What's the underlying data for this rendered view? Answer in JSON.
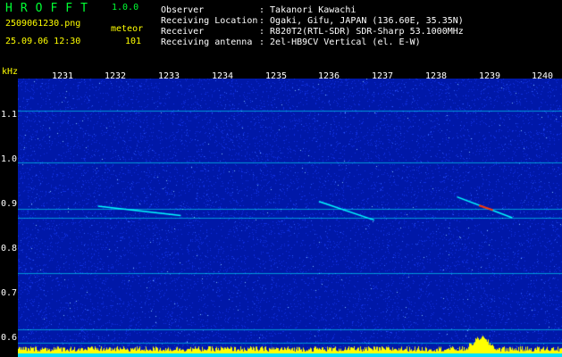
{
  "app": {
    "title": "HROFFT",
    "version": "1.0.0"
  },
  "file": {
    "filename": "2509061230.png",
    "datetime": "25.09.06 12:30",
    "mode_label": "meteor",
    "count": "101"
  },
  "info": [
    {
      "label": "Observer",
      "value": ": Takanori Kawachi"
    },
    {
      "label": "Receiving Location",
      "value": ": Ogaki, Gifu, JAPAN (136.60E, 35.35N)"
    },
    {
      "label": "Receiver",
      "value": ": R820T2(RTL-SDR) SDR-Sharp 53.1000MHz"
    },
    {
      "label": "Receiving antenna",
      "value": ": 2el-HB9CV Vertical (el. E-W)"
    }
  ],
  "axis": {
    "unit": "kHz",
    "y_ticks": [
      "1.1",
      "1.0",
      "0.9",
      "0.8",
      "0.7",
      "0.6"
    ],
    "x_ticks": [
      "1231",
      "1232",
      "1233",
      "1234",
      "1235",
      "1236",
      "1237",
      "1238",
      "1239",
      "1240"
    ]
  },
  "colors": {
    "background": "#0018a8",
    "noise": "#1030e0",
    "signal": "#00ffff",
    "hot": "#ff3000",
    "footer": "#ffff00"
  },
  "chart_data": {
    "type": "heatmap",
    "x": [
      "1231",
      "1232",
      "1233",
      "1234",
      "1235",
      "1236",
      "1237",
      "1238",
      "1239",
      "1240"
    ],
    "y_unit": "kHz",
    "ylim": [
      0.59,
      1.19
    ],
    "carriers_khz": [
      1.12,
      1.01,
      0.91,
      0.89,
      0.77,
      0.65,
      0.62
    ],
    "meteor_traces": [
      {
        "start_minute": 1232.0,
        "end_minute": 1233.5,
        "start_khz": 0.915,
        "end_khz": 0.895
      },
      {
        "start_minute": 1236.0,
        "end_minute": 1237.0,
        "start_khz": 0.925,
        "end_khz": 0.885
      },
      {
        "start_minute": 1238.5,
        "end_minute": 1239.5,
        "start_khz": 0.935,
        "end_khz": 0.89
      }
    ]
  }
}
